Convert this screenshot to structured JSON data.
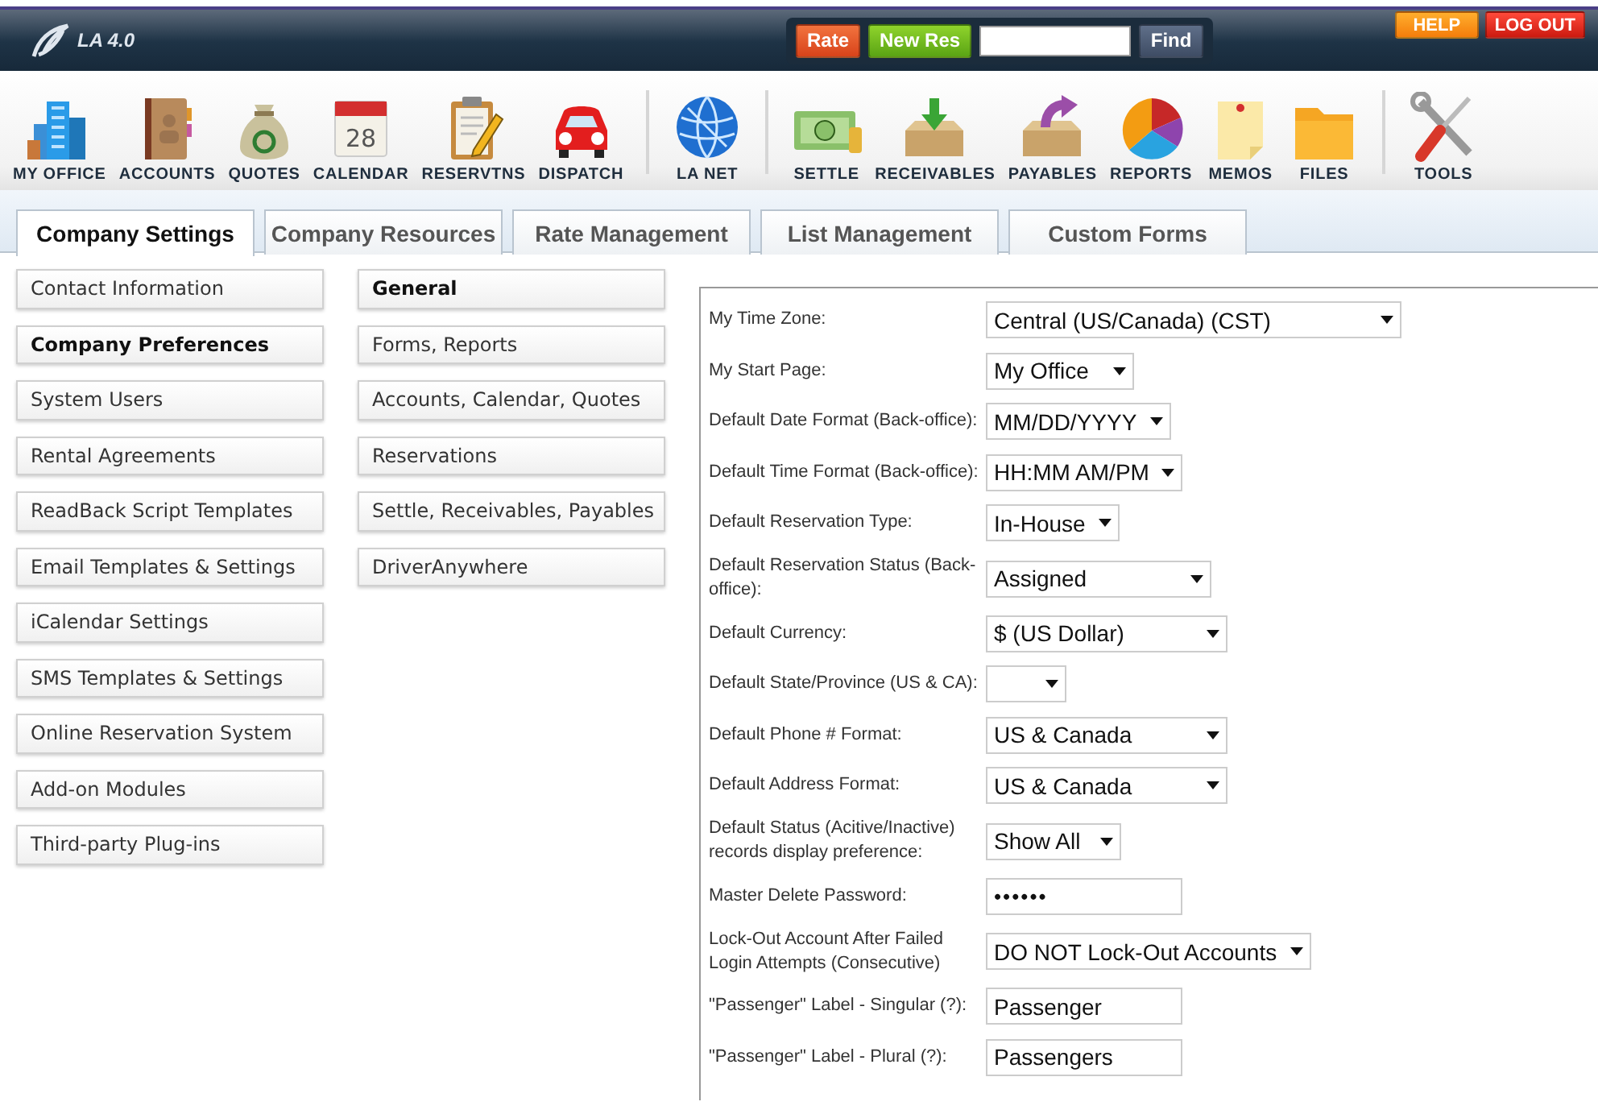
{
  "header": {
    "logo": "LA 4.0",
    "quick_bar": {
      "rate_button": "Rate",
      "new_res_button": "New Res",
      "find_button": "Find"
    },
    "help_button": "HELP",
    "logout_button": "LOG OUT"
  },
  "toolbar": {
    "groups": [
      [
        {
          "label": "MY OFFICE"
        },
        {
          "label": "ACCOUNTS"
        },
        {
          "label": "QUOTES"
        },
        {
          "label": "CALENDAR",
          "icon_text": "28"
        },
        {
          "label": "RESERVTNS"
        },
        {
          "label": "DISPATCH"
        }
      ],
      [
        {
          "label": "LA NET"
        }
      ],
      [
        {
          "label": "SETTLE"
        },
        {
          "label": "RECEIVABLES"
        },
        {
          "label": "PAYABLES"
        },
        {
          "label": "REPORTS"
        },
        {
          "label": "MEMOS"
        },
        {
          "label": "FILES"
        }
      ],
      [
        {
          "label": "TOOLS"
        }
      ]
    ]
  },
  "tabs": [
    {
      "label": "Company Settings",
      "selected": true
    },
    {
      "label": "Company Resources",
      "selected": false
    },
    {
      "label": "Rate Management",
      "selected": false
    },
    {
      "label": "List Management",
      "selected": false
    },
    {
      "label": "Custom Forms",
      "selected": false
    }
  ],
  "settings_menu": [
    {
      "label": "Contact Information",
      "selected": false
    },
    {
      "label": "Company Preferences",
      "selected": true
    },
    {
      "label": "System Users",
      "selected": false
    },
    {
      "label": "Rental Agreements",
      "selected": false
    },
    {
      "label": "ReadBack Script Templates",
      "selected": false
    },
    {
      "label": "Email Templates & Settings",
      "selected": false
    },
    {
      "label": "iCalendar Settings",
      "selected": false
    },
    {
      "label": "SMS Templates & Settings",
      "selected": false
    },
    {
      "label": "Online Reservation System",
      "selected": false
    },
    {
      "label": "Add-on Modules",
      "selected": false
    },
    {
      "label": "Third-party Plug-ins",
      "selected": false
    }
  ],
  "preferences_menu": [
    {
      "label": "General",
      "selected": true
    },
    {
      "label": "Forms, Reports",
      "selected": false
    },
    {
      "label": "Accounts, Calendar, Quotes",
      "selected": false
    },
    {
      "label": "Reservations",
      "selected": false
    },
    {
      "label": "Settle, Receivables, Payables",
      "selected": false
    },
    {
      "label": "DriverAnywhere",
      "selected": false
    }
  ],
  "form": [
    {
      "kind": "select",
      "label": "My Time Zone:",
      "value": "Central (US/Canada) (CST)"
    },
    {
      "kind": "select",
      "label": "My Start Page:",
      "value": "My Office"
    },
    {
      "kind": "select",
      "label": "Default Date Format (Back-office):",
      "value": "MM/DD/YYYY"
    },
    {
      "kind": "select",
      "label": "Default Time Format (Back-office):",
      "value": "HH:MM AM/PM"
    },
    {
      "kind": "select",
      "label": "Default Reservation Type:",
      "value": "In-House"
    },
    {
      "kind": "select",
      "label": "Default Reservation Status (Back-office):",
      "value": "Assigned"
    },
    {
      "kind": "select",
      "label": "Default Currency:",
      "value": "$ (US Dollar)"
    },
    {
      "kind": "select",
      "label": "Default State/Province (US & CA):"
    },
    {
      "kind": "select",
      "label": "Default Phone # Format:",
      "value": "US & Canada"
    },
    {
      "kind": "select",
      "label": "Default Address Format:",
      "value": "US & Canada"
    },
    {
      "kind": "select",
      "label": "Default Status (Acitive/Inactive) records display preference:",
      "value": "Show All"
    },
    {
      "kind": "password",
      "label": "Master Delete Password:",
      "value": "••••••"
    },
    {
      "kind": "select",
      "label": "Lock-Out Account After Failed Login Attempts (Consecutive)",
      "value": "DO NOT Lock-Out Accounts"
    },
    {
      "kind": "text",
      "label": "\"Passenger\" Label - Singular (?):",
      "value": "Passenger"
    },
    {
      "kind": "text",
      "label": "\"Passenger\" Label - Plural (?):",
      "value": "Passengers"
    }
  ]
}
